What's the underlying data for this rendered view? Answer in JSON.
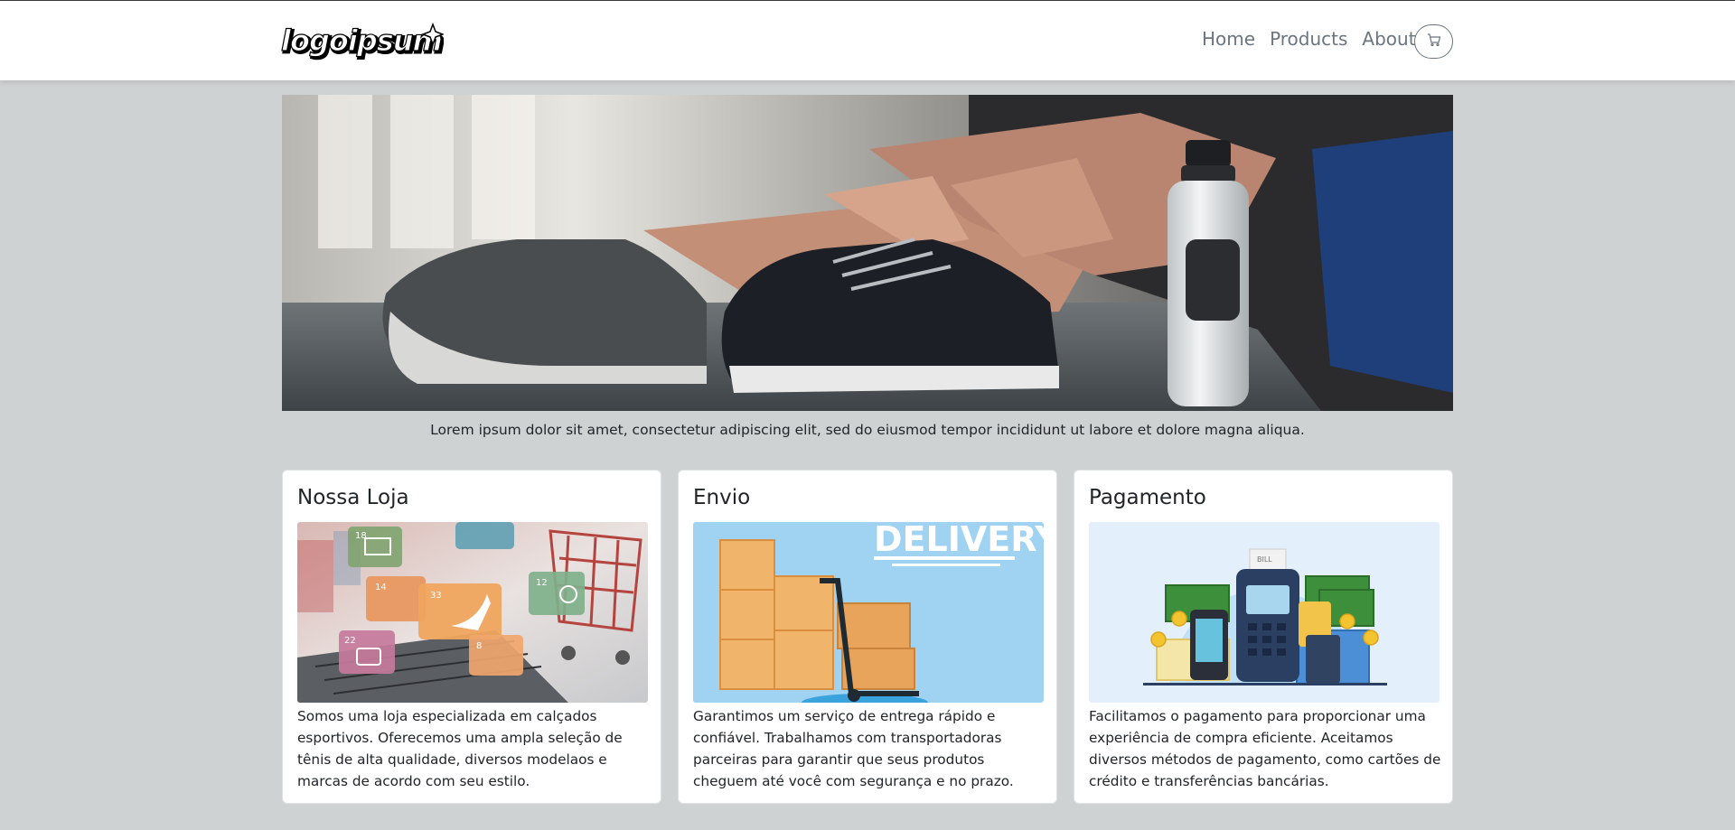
{
  "brand": {
    "logo_text": "logoipsum"
  },
  "nav": {
    "items": [
      {
        "label": "Home"
      },
      {
        "label": "Products"
      },
      {
        "label": "About"
      }
    ],
    "cart_icon": "cart-icon"
  },
  "hero": {
    "image": "sneaker-tying-photo",
    "caption": "Lorem ipsum dolor sit amet, consectetur adipiscing elit, sed do eiusmod tempor incididunt ut labore et dolore magna aliqua."
  },
  "cards": [
    {
      "title": "Nossa Loja",
      "image": "online-shopping-laptop-cart",
      "text": "Somos uma loja especializada em calçados esportivos. Oferecemos uma ampla seleção de tênis de alta qualidade, diversos modelaos e marcas de acordo com seu estilo.",
      "badges": [
        "18",
        "14",
        "33",
        "12",
        "22",
        "8"
      ]
    },
    {
      "title": "Envio",
      "image": "delivery-boxes-hand-truck",
      "banner": "DELIVERY",
      "text": "Garantimos um serviço de entrega rápido e confiável. Trabalhamos com transportadoras parceiras para garantir que seus produtos cheguem até você com segurança e no prazo."
    },
    {
      "title": "Pagamento",
      "image": "payment-terminal-money",
      "bill_label": "BILL",
      "text": "Facilitamos o pagamento para proporcionar uma experiência de compra eficiente. Aceitamos diversos métodos de pagamento, como cartões de crédito e transferências bancárias."
    }
  ],
  "colors": {
    "page_bg": "#cfd2d3",
    "nav_bg": "#ffffff",
    "nav_link": "#6c757d",
    "delivery_sky": "#9fd3f1",
    "payment_bg": "#e3f0fb"
  }
}
